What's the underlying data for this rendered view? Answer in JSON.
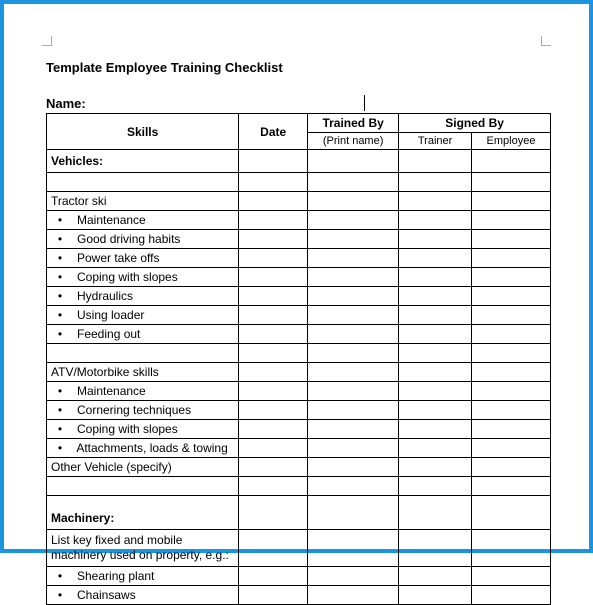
{
  "title": "Template Employee Training Checklist",
  "name_label": "Name:",
  "headers": {
    "skills": "Skills",
    "date": "Date",
    "trained_by": "Trained By",
    "trained_by_sub": "(Print name)",
    "signed_by": "Signed By",
    "trainer": "Trainer",
    "employee": "Employee"
  },
  "rows": [
    {
      "type": "section",
      "text": "Vehicles:"
    },
    {
      "type": "blank"
    },
    {
      "type": "subhead",
      "text": "Tractor ski"
    },
    {
      "type": "bullet",
      "text": "Maintenance"
    },
    {
      "type": "bullet",
      "text": "Good driving habits"
    },
    {
      "type": "bullet",
      "text": "Power take offs"
    },
    {
      "type": "bullet",
      "text": "Coping with slopes"
    },
    {
      "type": "bullet",
      "text": "Hydraulics"
    },
    {
      "type": "bullet",
      "text": "Using loader"
    },
    {
      "type": "bullet",
      "text": "Feeding out"
    },
    {
      "type": "blank"
    },
    {
      "type": "subhead",
      "text": "ATV/Motorbike skills"
    },
    {
      "type": "bullet",
      "text": "Maintenance"
    },
    {
      "type": "bullet",
      "text": "Cornering techniques"
    },
    {
      "type": "bullet",
      "text": "Coping with slopes"
    },
    {
      "type": "bullet",
      "text": "Attachments, loads & towing"
    },
    {
      "type": "subhead",
      "text": "Other Vehicle (specify)"
    },
    {
      "type": "blank"
    },
    {
      "type": "section_tall",
      "text": "Machinery:"
    },
    {
      "type": "wrap",
      "text": "List key fixed and mobile machinery used on property, e.g.:"
    },
    {
      "type": "bullet",
      "text": "Shearing plant"
    },
    {
      "type": "bullet",
      "text": "Chainsaws"
    }
  ]
}
